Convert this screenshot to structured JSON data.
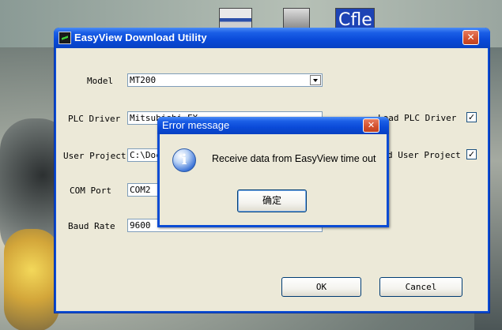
{
  "desktop": {
    "icons": [
      {
        "name": "desktop-shortcut-1"
      },
      {
        "name": "desktop-shortcut-2"
      },
      {
        "name": "desktop-shortcut-3",
        "label": "Cfle"
      }
    ]
  },
  "main_dialog": {
    "title": "EasyView Download Utility",
    "close_glyph": "✕",
    "fields": {
      "model": {
        "label": "Model",
        "value": "MT200"
      },
      "plc_driver": {
        "label": "PLC Driver",
        "value": "Mitsubishi FX"
      },
      "user_project": {
        "label": "User Project",
        "value": "C:\\Doc"
      },
      "com_port": {
        "label": "COM Port",
        "value": "COM2"
      },
      "baud_rate": {
        "label": "Baud Rate",
        "value": "9600"
      }
    },
    "checks": {
      "load_plc_driver": {
        "label": "Load PLC Driver",
        "checked": "✓"
      },
      "load_user_project": {
        "label": "d User Project",
        "checked": "✓"
      }
    },
    "buttons": {
      "ok": "OK",
      "cancel": "Cancel"
    }
  },
  "error_dialog": {
    "title": "Error message",
    "close_glyph": "✕",
    "icon_glyph": "i",
    "message": "Receive data from EasyView time out",
    "ok_label": "确定"
  },
  "colors": {
    "titlebar": "#0a4ad8",
    "client_bg": "#ece9d8",
    "close_button": "#d3502d"
  }
}
